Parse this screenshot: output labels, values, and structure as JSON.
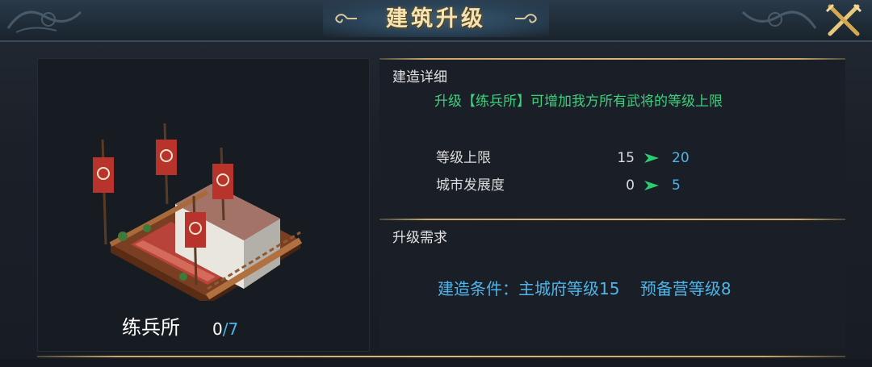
{
  "window": {
    "title": "建筑升级"
  },
  "building": {
    "name": "练兵所",
    "count": "0",
    "max": "/7"
  },
  "details": {
    "section_title": "建造详细",
    "description": "升级【练兵所】可增加我方所有武将的等级上限",
    "stats": [
      {
        "label": "等级上限",
        "from": "15",
        "to": "20"
      },
      {
        "label": "城市发展度",
        "from": "0",
        "to": "5"
      }
    ]
  },
  "requirements": {
    "section_title": "升级需求",
    "text": "建造条件：主城府等级15    预备营等级8"
  },
  "colors": {
    "gold_accent": "#c9a86a",
    "title_text": "#f4e3b3",
    "green_text": "#3ed07e",
    "blue_value": "#4fb4e8",
    "panel_bg": "#1a1e26"
  },
  "icons": {
    "close": "crossed-swords-close-icon",
    "arrow": "green-arrow-right-icon",
    "title_ornament": "cloud-scroll-ornament-icon"
  }
}
